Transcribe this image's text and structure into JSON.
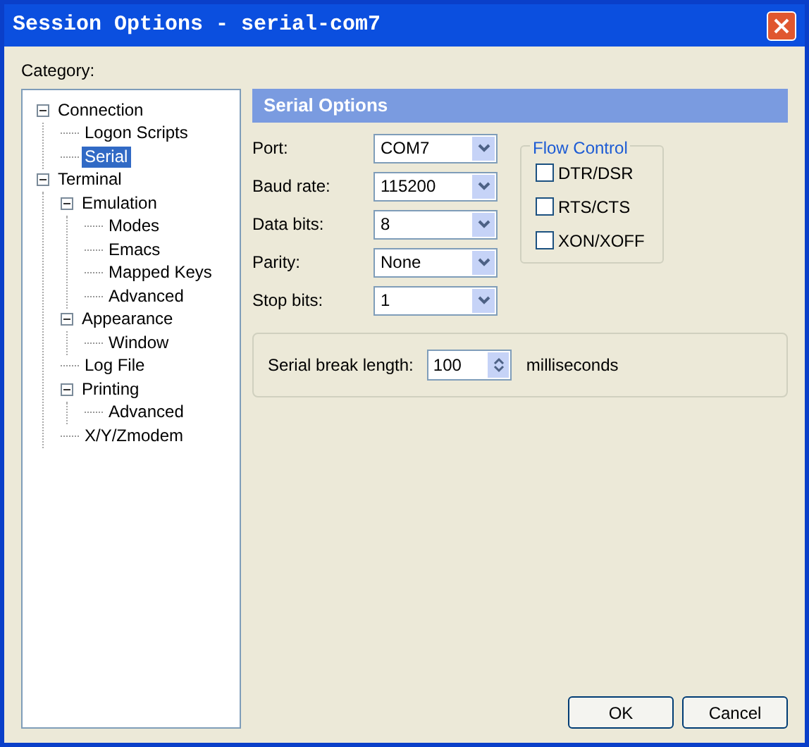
{
  "window": {
    "title": "Session Options - serial-com7"
  },
  "category_label": "Category:",
  "tree": [
    {
      "label": "Connection",
      "expanded": true,
      "selected": false,
      "children": [
        {
          "label": "Logon Scripts",
          "selected": false
        },
        {
          "label": "Serial",
          "selected": true
        }
      ]
    },
    {
      "label": "Terminal",
      "expanded": true,
      "selected": false,
      "children": [
        {
          "label": "Emulation",
          "expanded": true,
          "selected": false,
          "children": [
            {
              "label": "Modes",
              "selected": false
            },
            {
              "label": "Emacs",
              "selected": false
            },
            {
              "label": "Mapped Keys",
              "selected": false
            },
            {
              "label": "Advanced",
              "selected": false
            }
          ]
        },
        {
          "label": "Appearance",
          "expanded": true,
          "selected": false,
          "children": [
            {
              "label": "Window",
              "selected": false
            }
          ]
        },
        {
          "label": "Log File",
          "selected": false
        },
        {
          "label": "Printing",
          "expanded": true,
          "selected": false,
          "children": [
            {
              "label": "Advanced",
              "selected": false
            }
          ]
        },
        {
          "label": "X/Y/Zmodem",
          "selected": false
        }
      ]
    }
  ],
  "panel_title": "Serial Options",
  "fields": [
    {
      "label": "Port:",
      "value": "COM7"
    },
    {
      "label": "Baud rate:",
      "value": "115200"
    },
    {
      "label": "Data bits:",
      "value": "8"
    },
    {
      "label": "Parity:",
      "value": "None"
    },
    {
      "label": "Stop bits:",
      "value": "1"
    }
  ],
  "flow_control": {
    "title": "Flow Control",
    "options": [
      {
        "label": "DTR/DSR",
        "checked": false
      },
      {
        "label": "RTS/CTS",
        "checked": false
      },
      {
        "label": "XON/XOFF",
        "checked": false
      }
    ]
  },
  "break_length": {
    "label": "Serial break length:",
    "value": "100",
    "unit": "milliseconds"
  },
  "buttons": [
    "OK",
    "Cancel"
  ]
}
